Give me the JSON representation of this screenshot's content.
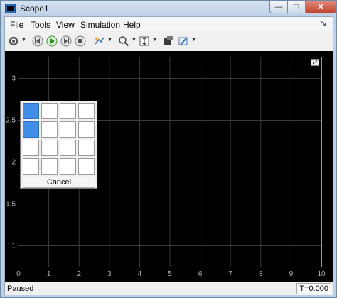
{
  "window": {
    "title": "Scope1",
    "minimize_glyph": "—",
    "maximize_glyph": "□",
    "close_glyph": "✕"
  },
  "menu": {
    "items": [
      "File",
      "Tools",
      "View",
      "Simulation",
      "Help"
    ],
    "end_glyph": "↘"
  },
  "toolbar": {
    "icons": [
      "settings-icon",
      "step-back-icon",
      "run-icon",
      "step-forward-icon",
      "stop-icon",
      "highlight-icon",
      "zoom-icon",
      "autoscale-icon",
      "layout-icon",
      "style-icon"
    ]
  },
  "plot": {
    "background": "#000000",
    "grid_color": "#3a3a3a",
    "tick_color": "#b4b4b4",
    "expand_glyph": "⤢"
  },
  "chart_data": {
    "type": "line",
    "title": "",
    "xlabel": "",
    "ylabel": "",
    "xlim": [
      0,
      10
    ],
    "ylim": [
      0.75,
      3.25
    ],
    "x_ticks": [
      0,
      1,
      2,
      3,
      4,
      5,
      6,
      7,
      8,
      9,
      10
    ],
    "y_ticks": [
      1,
      1.5,
      2,
      2.5,
      3
    ],
    "x_tick_labels": [
      "0",
      "1",
      "2",
      "3",
      "4",
      "5",
      "6",
      "7",
      "8",
      "9",
      "10"
    ],
    "y_tick_labels": [
      "1",
      "1.5",
      "2",
      "2.5",
      "3"
    ],
    "grid": true,
    "series": []
  },
  "layout_picker": {
    "rows": 4,
    "cols": 4,
    "selected": [
      [
        0,
        0
      ],
      [
        1,
        0
      ]
    ],
    "selected_color": "#3f8fe8",
    "cancel_label": "Cancel"
  },
  "status": {
    "text": "Paused",
    "time": "T=0.000"
  }
}
